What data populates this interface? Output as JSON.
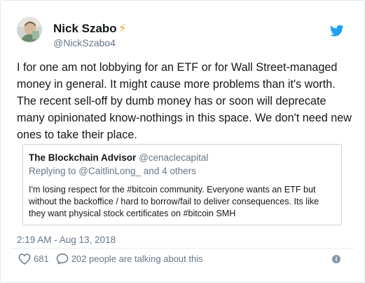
{
  "author": {
    "name": "Nick Szabo",
    "name_suffix": "⚡",
    "handle": "@NickSzabo4"
  },
  "tweet": {
    "text": "I for one am not lobbying for an ETF or for Wall Street-managed money in general. It might cause more problems than it's worth. The recent sell-off by dumb money has or soon will deprecate many opinionated know-nothings in this space. We don't need new ones to take their place.",
    "timestamp": "2:19 AM - Aug 13, 2018"
  },
  "quoted": {
    "name": "The Blockchain Advisor",
    "handle": "@cenaclecapital",
    "replying_to": "Replying to @CaitlinLong_ and 4 others",
    "text": "I'm losing respect for the #bitcoin community. Everyone wants an ETF but without the backoffice / hard to borrow/fail to deliver consequences. Its like they want physical stock certificates on #bitcoin SMH"
  },
  "actions": {
    "like_count": "681",
    "talking_text": "202 people are talking about this"
  },
  "icons": {
    "brand": "twitter-bird-icon",
    "like": "heart-icon",
    "reply": "speech-bubble-icon",
    "info": "info-icon"
  },
  "colors": {
    "brand": "#1da1f2",
    "lightning": "#f5a623",
    "muted": "#657786"
  }
}
